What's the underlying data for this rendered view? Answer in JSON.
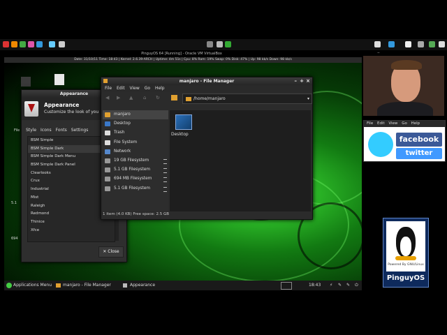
{
  "host": {
    "vm_title": "PinguyOS 64 [Running] - Oracle VM VirtualBox",
    "status_bar": "Date: 31/10/11 Time: 18:43 | Kernel: 2.6.39-ARCH | Uptime: 4m 51s | Cpu: 8% Ram: 19% Swap: 0% Disk: 47% | Up: 98 kb/s Down: 98 kb/s"
  },
  "appearance": {
    "window_title": "Appearance",
    "heading": "Appearance",
    "subtitle": "Customize the look of you",
    "tabs": [
      "Style",
      "Icons",
      "Fonts",
      "Settings"
    ],
    "themes": [
      "BSM Simple",
      "BSM Simple Dark",
      "BSM Simple Dark Menu",
      "BSM Simple Dark Panel",
      "Clearlooks",
      "Crux",
      "Industrial",
      "Mist",
      "Raleigh",
      "Redmond",
      "Thinice",
      "Xfce"
    ],
    "selected_theme": "BSM Simple Dark",
    "close_label": "Close"
  },
  "filemanager": {
    "window_title": "manjaro - File Manager",
    "menu": [
      "File",
      "Edit",
      "View",
      "Go",
      "Help"
    ],
    "address": "/home/manjaro",
    "places": [
      {
        "label": "manjaro",
        "color": "#e0a030",
        "eject": false
      },
      {
        "label": "Desktop",
        "color": "#3a78c8",
        "eject": false
      },
      {
        "label": "Trash",
        "color": "#dddddd",
        "eject": false
      },
      {
        "label": "File System",
        "color": "#dddddd",
        "eject": false
      },
      {
        "label": "Network",
        "color": "#5588cc",
        "eject": false
      },
      {
        "label": "19 GB Filesystem",
        "color": "#999999",
        "eject": true
      },
      {
        "label": "5.1 GB Filesystem",
        "color": "#999999",
        "eject": true
      },
      {
        "label": "694 MB Filesystem",
        "color": "#999999",
        "eject": true
      },
      {
        "label": "5.1 GB Filesystem",
        "color": "#999999",
        "eject": true
      }
    ],
    "item_label": "Desktop",
    "status": "1 item (4.0 KB) Free space: 2.5 GB"
  },
  "desktop_labels": [
    "File",
    "5.1",
    "694"
  ],
  "taskbar": {
    "menu": "Applications Menu",
    "task1": "manjaro - File Manager",
    "task2": "Appearance",
    "clock": "18:43"
  },
  "social": {
    "menu": [
      "File",
      "Edit",
      "View",
      "Go",
      "Help"
    ],
    "facebook": "facebook",
    "twitter": "twitter"
  },
  "badge": {
    "powered": "Powered By GNU/Linux",
    "name": "PinguyOS"
  }
}
